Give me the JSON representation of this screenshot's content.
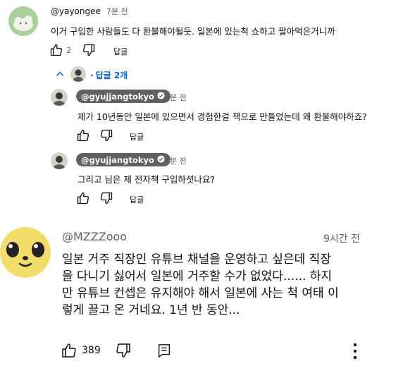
{
  "comment1": {
    "handle": "@yayongee",
    "time": "7분 전",
    "text": "이거 구입한 사람들도 다 환불해야될듯. 일본에 있는척 쇼하고 팔아먹은거니까",
    "likes": "2",
    "reply_label": "답글"
  },
  "replies_toggle": {
    "label": "답글 2개"
  },
  "reply1": {
    "handle": "@gyujjangtokyo",
    "time": "3분 전",
    "text": "제가 10년동안 일본에 있으면서 경험한걸 책으로 만들었는데 왜 환불해야하죠?",
    "reply_label": "답글"
  },
  "reply2": {
    "handle": "@gyujjangtokyo",
    "time": "2분 전",
    "text": "그리고 님은 제 전자책 구입하셧나요?",
    "reply_label": "답글"
  },
  "comment2": {
    "handle": "@MZZZooo",
    "time": "9시간 전",
    "lines": [
      "일본 거주 직장인 유튜브 채널을 운영하고 싶은데 직장",
      "을 다니기 싫어서 일본에 거주할 수가 없었다...... 하지",
      "만 유튜브 컨셉은 유지해야 해서 일본에 사는 척 여태 이",
      "렇게 끌고 온 거네요. 1년 반 동안..."
    ],
    "likes": "389"
  },
  "colors": {
    "link": "#065fd4",
    "muted": "#606060",
    "pill": "#606060"
  },
  "icons": [
    "thumb-up-icon",
    "thumb-down-icon",
    "reply-icon",
    "more-vert-icon",
    "chevron-up-icon",
    "verified-check-icon"
  ]
}
